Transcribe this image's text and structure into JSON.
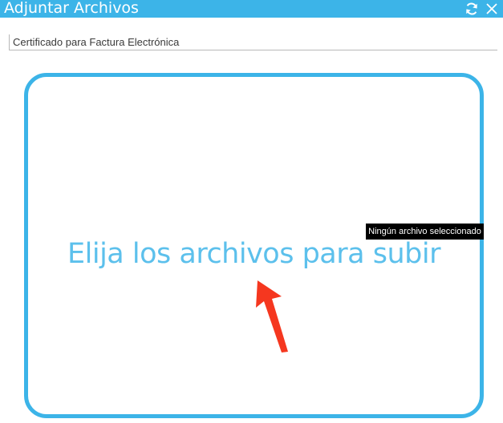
{
  "window": {
    "title": "Adjuntar Archivos",
    "refresh_icon": "refresh-icon",
    "close_icon": "close-icon",
    "accent_color": "#3cb4e8"
  },
  "form": {
    "field_label": "Certificado para Factura Electrónica"
  },
  "dropzone": {
    "prompt": "Elija los archivos para subir",
    "tooltip": "Ningún archivo seleccionado",
    "annotation_icon": "red-arrow-icon",
    "annotation_color": "#f5371f"
  }
}
